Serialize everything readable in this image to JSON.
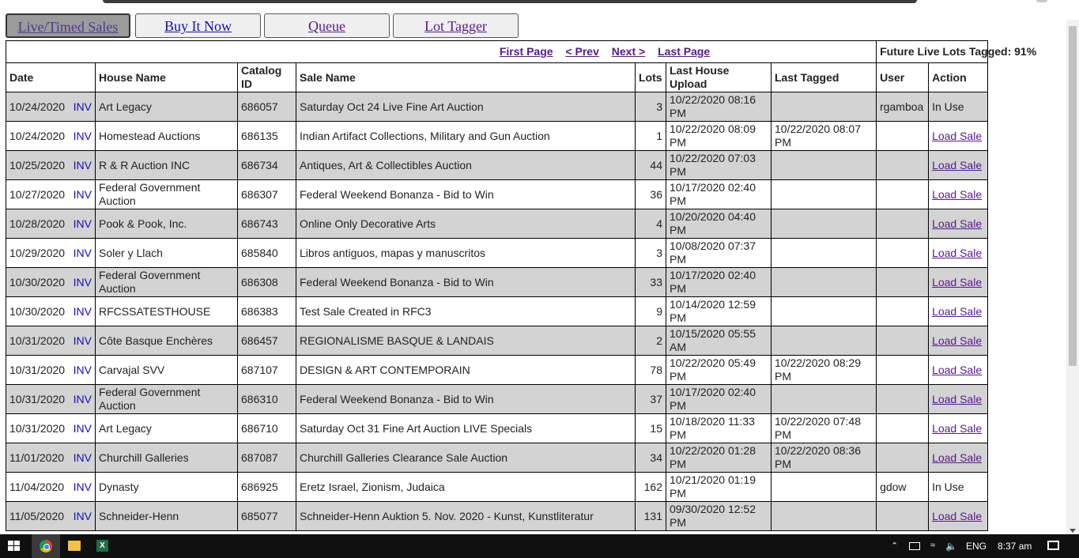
{
  "tabs": [
    {
      "label": "Live/Timed Sales",
      "active": true
    },
    {
      "label": "Buy It Now",
      "active": false
    },
    {
      "label": "Queue",
      "active": false
    },
    {
      "label": "Lot Tagger",
      "active": false
    }
  ],
  "pager": {
    "first": "First Page",
    "prev": "< Prev",
    "next": "Next >",
    "last": "Last Page",
    "future_tagged": "Future Live Lots Tagged: 91%"
  },
  "columns": [
    "Date",
    "House Name",
    "Catalog ID",
    "Sale Name",
    "Lots",
    "Last House Upload",
    "Last Tagged",
    "User",
    "Action"
  ],
  "inv_label": "INV",
  "rows": [
    {
      "date": "10/24/2020",
      "house": "Art Legacy",
      "catalog": "686057",
      "sale": "Saturday Oct 24 Live Fine Art Auction",
      "lots": "3",
      "upload": "10/22/2020 08:16 PM",
      "tagged": "",
      "user": "rgamboa",
      "action": "In Use"
    },
    {
      "date": "10/24/2020",
      "house": "Homestead Auctions",
      "catalog": "686135",
      "sale": "Indian Artifact Collections, Military and Gun Auction",
      "lots": "1",
      "upload": "10/22/2020 08:09 PM",
      "tagged": "10/22/2020 08:07 PM",
      "user": "",
      "action": "Load Sale"
    },
    {
      "date": "10/25/2020",
      "house": "R & R Auction INC",
      "catalog": "686734",
      "sale": "Antiques, Art & Collectibles Auction",
      "lots": "44",
      "upload": "10/22/2020 07:03 PM",
      "tagged": "",
      "user": "",
      "action": "Load Sale"
    },
    {
      "date": "10/27/2020",
      "house": "Federal Government Auction",
      "catalog": "686307",
      "sale": "Federal Weekend Bonanza - Bid to Win",
      "lots": "36",
      "upload": "10/17/2020 02:40 PM",
      "tagged": "",
      "user": "",
      "action": "Load Sale"
    },
    {
      "date": "10/28/2020",
      "house": "Pook & Pook, Inc.",
      "catalog": "686743",
      "sale": "Online Only Decorative Arts",
      "lots": "4",
      "upload": "10/20/2020 04:40 PM",
      "tagged": "",
      "user": "",
      "action": "Load Sale"
    },
    {
      "date": "10/29/2020",
      "house": "Soler y Llach",
      "catalog": "685840",
      "sale": "Libros antiguos, mapas y manuscritos",
      "lots": "3",
      "upload": "10/08/2020 07:37 PM",
      "tagged": "",
      "user": "",
      "action": "Load Sale"
    },
    {
      "date": "10/30/2020",
      "house": "Federal Government Auction",
      "catalog": "686308",
      "sale": "Federal Weekend Bonanza - Bid to Win",
      "lots": "33",
      "upload": "10/17/2020 02:40 PM",
      "tagged": "",
      "user": "",
      "action": "Load Sale"
    },
    {
      "date": "10/30/2020",
      "house": "RFCSSATESTHOUSE",
      "catalog": "686383",
      "sale": "Test Sale Created in RFC3",
      "lots": "9",
      "upload": "10/14/2020 12:59 PM",
      "tagged": "",
      "user": "",
      "action": "Load Sale"
    },
    {
      "date": "10/31/2020",
      "house": "Côte Basque Enchères",
      "catalog": "686457",
      "sale": "REGIONALISME BASQUE & LANDAIS",
      "lots": "2",
      "upload": "10/15/2020 05:55 AM",
      "tagged": "",
      "user": "",
      "action": "Load Sale"
    },
    {
      "date": "10/31/2020",
      "house": "Carvajal SVV",
      "catalog": "687107",
      "sale": "DESIGN & ART CONTEMPORAIN",
      "lots": "78",
      "upload": "10/22/2020 05:49 PM",
      "tagged": "10/22/2020 08:29 PM",
      "user": "",
      "action": "Load Sale"
    },
    {
      "date": "10/31/2020",
      "house": "Federal Government Auction",
      "catalog": "686310",
      "sale": "Federal Weekend Bonanza - Bid to Win",
      "lots": "37",
      "upload": "10/17/2020 02:40 PM",
      "tagged": "",
      "user": "",
      "action": "Load Sale"
    },
    {
      "date": "10/31/2020",
      "house": "Art Legacy",
      "catalog": "686710",
      "sale": "Saturday Oct 31 Fine Art Auction LIVE Specials",
      "lots": "15",
      "upload": "10/18/2020 11:33 PM",
      "tagged": "10/22/2020 07:48 PM",
      "user": "",
      "action": "Load Sale"
    },
    {
      "date": "11/01/2020",
      "house": "Churchill Galleries",
      "catalog": "687087",
      "sale": "Churchill Galleries Clearance Sale Auction",
      "lots": "34",
      "upload": "10/22/2020 01:28 PM",
      "tagged": "10/22/2020 08:36 PM",
      "user": "",
      "action": "Load Sale"
    },
    {
      "date": "11/04/2020",
      "house": "Dynasty",
      "catalog": "686925",
      "sale": "Eretz Israel, Zionism, Judaica",
      "lots": "162",
      "upload": "10/21/2020 01:19 PM",
      "tagged": "",
      "user": "gdow",
      "action": "In Use"
    },
    {
      "date": "11/05/2020",
      "house": "Schneider-Henn",
      "catalog": "685077",
      "sale": "Schneider-Henn Auktion 5. Nov. 2020 - Kunst, Kunstliteratur",
      "lots": "131",
      "upload": "09/30/2020 12:52 PM",
      "tagged": "",
      "user": "",
      "action": "Load Sale"
    }
  ],
  "taskbar": {
    "language": "ENG",
    "time": "8:37 am"
  }
}
